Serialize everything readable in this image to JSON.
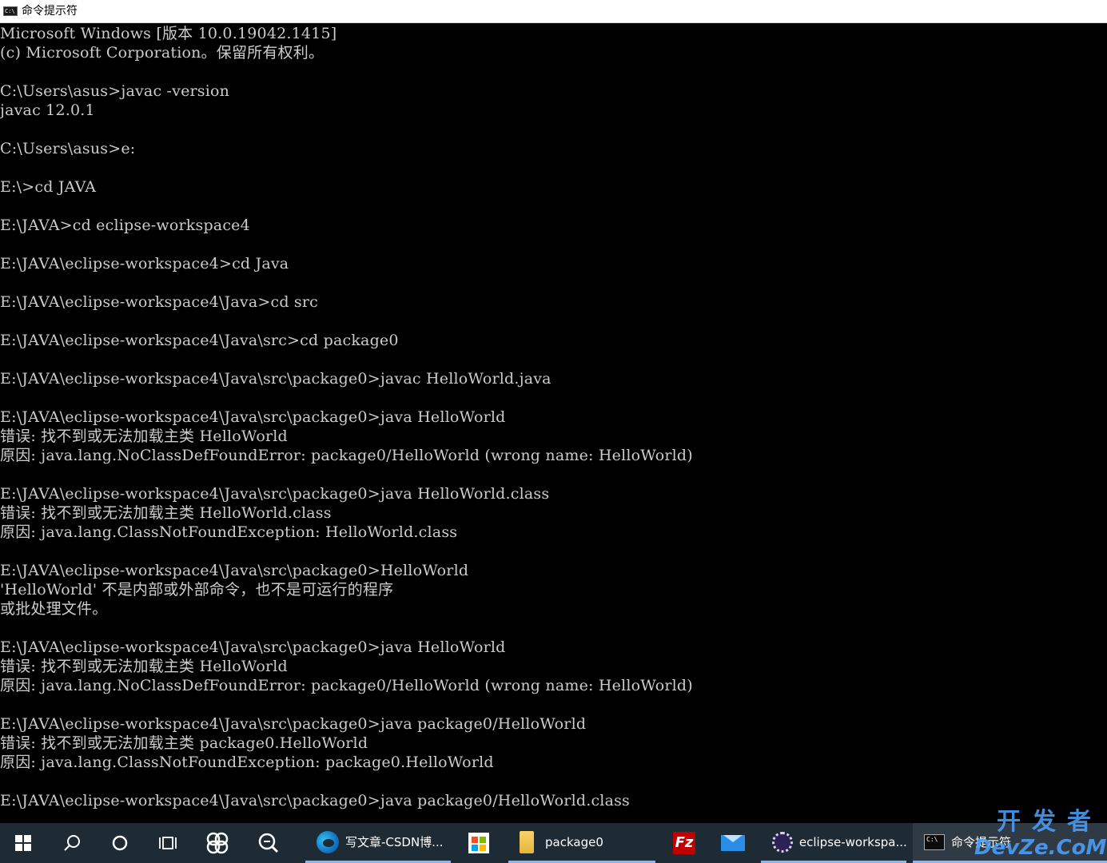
{
  "window": {
    "title": "命令提示符",
    "icon": "cmd-icon"
  },
  "console": {
    "lines": [
      "Microsoft Windows [版本 10.0.19042.1415]",
      "(c) Microsoft Corporation。保留所有权利。",
      "",
      "C:\\Users\\asus>javac -version",
      "javac 12.0.1",
      "",
      "C:\\Users\\asus>e:",
      "",
      "E:\\>cd JAVA",
      "",
      "E:\\JAVA>cd eclipse-workspace4",
      "",
      "E:\\JAVA\\eclipse-workspace4>cd Java",
      "",
      "E:\\JAVA\\eclipse-workspace4\\Java>cd src",
      "",
      "E:\\JAVA\\eclipse-workspace4\\Java\\src>cd package0",
      "",
      "E:\\JAVA\\eclipse-workspace4\\Java\\src\\package0>javac HelloWorld.java",
      "",
      "E:\\JAVA\\eclipse-workspace4\\Java\\src\\package0>java HelloWorld",
      "错误: 找不到或无法加载主类 HelloWorld",
      "原因: java.lang.NoClassDefFoundError: package0/HelloWorld (wrong name: HelloWorld)",
      "",
      "E:\\JAVA\\eclipse-workspace4\\Java\\src\\package0>java HelloWorld.class",
      "错误: 找不到或无法加载主类 HelloWorld.class",
      "原因: java.lang.ClassNotFoundException: HelloWorld.class",
      "",
      "E:\\JAVA\\eclipse-workspace4\\Java\\src\\package0>HelloWorld",
      "'HelloWorld' 不是内部或外部命令，也不是可运行的程序",
      "或批处理文件。",
      "",
      "E:\\JAVA\\eclipse-workspace4\\Java\\src\\package0>java HelloWorld",
      "错误: 找不到或无法加载主类 HelloWorld",
      "原因: java.lang.NoClassDefFoundError: package0/HelloWorld (wrong name: HelloWorld)",
      "",
      "E:\\JAVA\\eclipse-workspace4\\Java\\src\\package0>java package0/HelloWorld",
      "错误: 找不到或无法加载主类 package0.HelloWorld",
      "原因: java.lang.ClassNotFoundException: package0.HelloWorld",
      "",
      "E:\\JAVA\\eclipse-workspace4\\Java\\src\\package0>java package0/HelloWorld.class"
    ]
  },
  "taskbar": {
    "start_icon": "windows-logo-icon",
    "search_icon": "search-icon",
    "cortana_icon": "circle-icon",
    "taskview_icon": "task-view-icon",
    "apps": [
      {
        "label": "写文章-CSDN博...",
        "icon": "edge-icon"
      },
      {
        "label": "",
        "icon": "store-icon"
      },
      {
        "label": "package0",
        "icon": "folder-icon"
      },
      {
        "label": "",
        "icon": "filezilla-icon"
      },
      {
        "label": "",
        "icon": "mail-icon"
      },
      {
        "label": "eclipse-workspa...",
        "icon": "eclipse-icon"
      },
      {
        "label": "命令提示符",
        "icon": "cmd-icon"
      }
    ]
  },
  "watermark": {
    "top": "开发者",
    "bottom": "DevZe.CoM"
  },
  "colors": {
    "console_bg": "#000000",
    "console_text": "#cccccc",
    "taskbar_bg": "#1e2a34",
    "accent": "#8ab4f8"
  }
}
